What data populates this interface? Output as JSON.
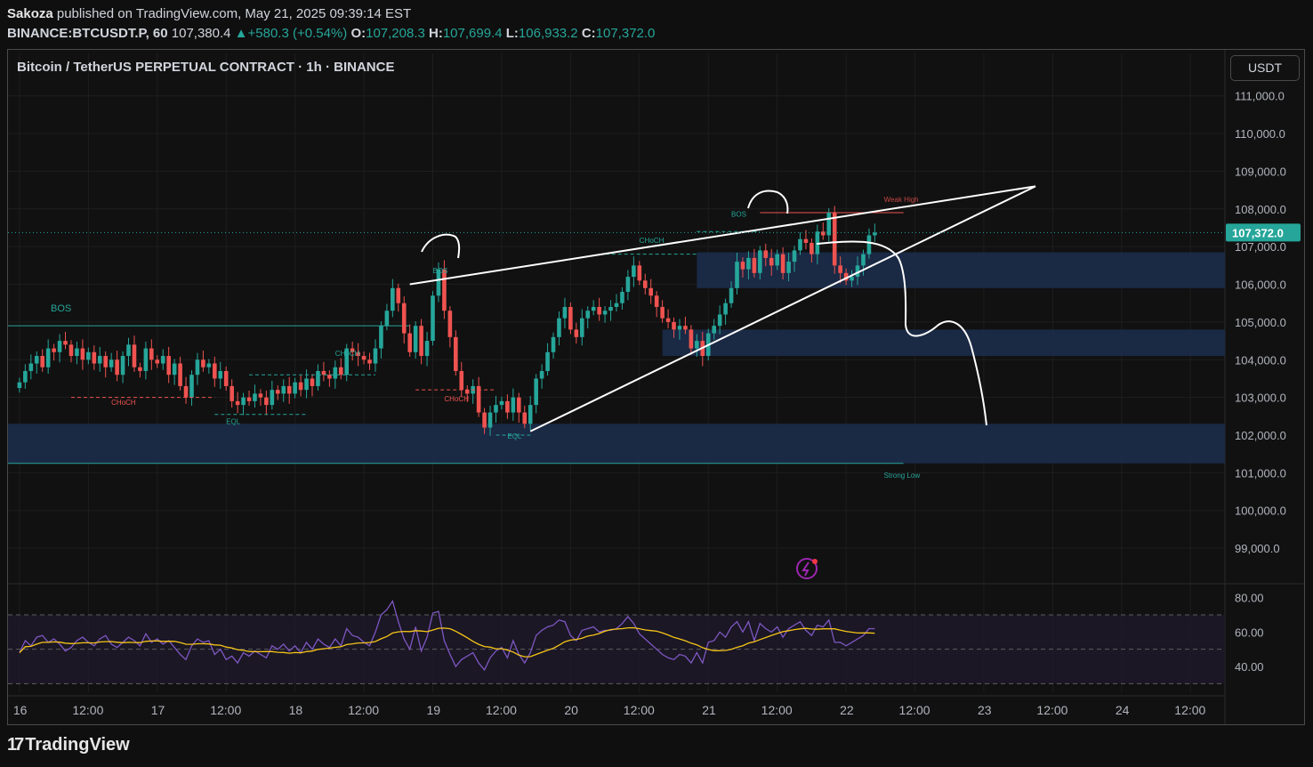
{
  "header": {
    "author": "Sakoza",
    "published_text": "published on TradingView.com, May 21, 2025 09:39:14 EST",
    "symbol": "BINANCE:BTCUSDT.P, 60",
    "last": "107,380.4",
    "change": "▲+580.3 (+0.54%)",
    "o_label": "O:",
    "o": "107,208.3",
    "h_label": "H:",
    "h": "107,699.4",
    "l_label": "L:",
    "l": "106,933.2",
    "c_label": "C:",
    "c": "107,372.0"
  },
  "chart_title": "Bitcoin / TetherUS PERPETUAL CONTRACT · 1h · BINANCE",
  "currency_button": "USDT",
  "footer": {
    "brand": "TradingView"
  },
  "colors": {
    "up": "#26a69a",
    "down": "#ef5350",
    "zone": "#1c2c4a",
    "bos": "#26a69a",
    "choch_red": "#ef5350",
    "rsi": "#7e57c2",
    "rsi_ma": "#f5c518",
    "price_tag": "#26a69a"
  },
  "chart_data": {
    "type": "candlestick",
    "title": "Bitcoin / TetherUS PERPETUAL CONTRACT · 1h · BINANCE",
    "y_ticks": [
      "111,000.0",
      "110,000.0",
      "109,000.0",
      "108,000.0",
      "107,000.0",
      "106,000.0",
      "105,000.0",
      "104,000.0",
      "103,000.0",
      "102,000.0",
      "101,000.0",
      "100,000.0",
      "99,000.0"
    ],
    "y_tick_values": [
      111000,
      110000,
      109000,
      108000,
      107000,
      106000,
      105000,
      104000,
      103000,
      102000,
      101000,
      100000,
      99000
    ],
    "ylim": [
      98200,
      111300
    ],
    "x_ticks": [
      "16",
      "12:00",
      "17",
      "12:00",
      "18",
      "12:00",
      "19",
      "12:00",
      "20",
      "12:00",
      "21",
      "12:00",
      "22",
      "12:00",
      "23",
      "12:00",
      "24",
      "12:00"
    ],
    "x_tick_hours": [
      0,
      12,
      24,
      36,
      48,
      60,
      72,
      84,
      96,
      108,
      120,
      132,
      144,
      156,
      168,
      180,
      192,
      204
    ],
    "x_axis_start": "May 16 00:00",
    "xlim_hours": [
      -2,
      210
    ],
    "last_price": "107,372.0",
    "last_price_value": 107372,
    "candles_hourly_close": [
      103400,
      103700,
      103900,
      104100,
      103800,
      104300,
      104200,
      104500,
      104400,
      104100,
      104300,
      104000,
      104200,
      103900,
      104100,
      103800,
      104000,
      103600,
      104100,
      104400,
      103800,
      103700,
      104300,
      104000,
      103900,
      104100,
      103600,
      103900,
      103300,
      103000,
      103600,
      104000,
      103800,
      103900,
      103500,
      103700,
      103300,
      102900,
      102800,
      103000,
      102900,
      103100,
      103000,
      102800,
      103200,
      103100,
      103300,
      103100,
      103400,
      103200,
      103500,
      103300,
      103700,
      103600,
      103500,
      103800,
      103600,
      104300,
      104200,
      104100,
      104000,
      103900,
      104300,
      104900,
      105300,
      105900,
      105500,
      104700,
      104200,
      104900,
      104100,
      104500,
      105700,
      106400,
      105300,
      104600,
      103700,
      103200,
      103100,
      103300,
      102600,
      102200,
      102600,
      102800,
      102900,
      102600,
      103000,
      102600,
      102300,
      102800,
      103500,
      103700,
      104200,
      104600,
      105100,
      105400,
      104800,
      104600,
      105100,
      105300,
      105400,
      105200,
      105300,
      105400,
      105500,
      105800,
      106200,
      106500,
      106100,
      105900,
      105700,
      105400,
      105100,
      105000,
      104800,
      104900,
      104800,
      104300,
      104500,
      104100,
      104700,
      104900,
      105200,
      105500,
      105900,
      106600,
      106400,
      106700,
      106300,
      106900,
      106700,
      106500,
      106800,
      106300,
      106600,
      106900,
      107200,
      107100,
      106800,
      107400,
      107300,
      107900,
      106500,
      106300,
      106100,
      106200,
      106500,
      106800,
      107300,
      107372
    ],
    "horizontal_levels": [
      {
        "label": "BOS",
        "value": 104900,
        "from_hour": -2,
        "to_hour": 68,
        "color": "bos"
      },
      {
        "label": "Strong Low",
        "value": 101250,
        "from_hour": -2,
        "to_hour": 154,
        "color": "bos"
      },
      {
        "label": "Weak High",
        "value": 107900,
        "from_hour": 129,
        "to_hour": 154,
        "color": "down"
      }
    ],
    "zones": [
      {
        "from_hour": 118,
        "to_hour": 210,
        "top": 106850,
        "bottom": 105900
      },
      {
        "from_hour": 112,
        "to_hour": 210,
        "top": 104800,
        "bottom": 104100
      },
      {
        "from_hour": -2,
        "to_hour": 210,
        "top": 102300,
        "bottom": 101250
      }
    ],
    "annotations": [
      {
        "text": "BOS",
        "hour": 72,
        "value": 106300,
        "color": "bos"
      },
      {
        "text": "CHoCH",
        "hour": 55,
        "value": 104100,
        "color": "bos"
      },
      {
        "text": "CHoCH",
        "hour": 16,
        "value": 102800,
        "color": "down"
      },
      {
        "text": "EQL",
        "hour": 36,
        "value": 102300,
        "color": "bos"
      },
      {
        "text": "CHoCH",
        "hour": 74,
        "value": 102900,
        "color": "down"
      },
      {
        "text": "EQL",
        "hour": 85,
        "value": 101900,
        "color": "bos"
      },
      {
        "text": "CHoCH",
        "hour": 108,
        "value": 107100,
        "color": "bos"
      },
      {
        "text": "BOS",
        "hour": 124,
        "value": 107800,
        "color": "bos"
      }
    ],
    "rsi": {
      "y_ticks": [
        "80.00",
        "60.00",
        "40.00"
      ],
      "y_tick_values": [
        80,
        60,
        40
      ],
      "ylim": [
        25,
        85
      ],
      "upper": 70,
      "lower": 30,
      "mid": 50,
      "values": [
        48,
        55,
        52,
        57,
        58,
        54,
        56,
        53,
        49,
        51,
        55,
        57,
        54,
        52,
        56,
        58,
        53,
        51,
        54,
        57,
        55,
        52,
        59,
        54,
        56,
        53,
        55,
        51,
        47,
        44,
        52,
        56,
        54,
        55,
        47,
        50,
        44,
        46,
        42,
        48,
        46,
        49,
        47,
        45,
        52,
        50,
        53,
        49,
        52,
        48,
        54,
        50,
        56,
        53,
        51,
        56,
        52,
        62,
        58,
        57,
        54,
        52,
        60,
        70,
        73,
        78,
        66,
        56,
        50,
        63,
        49,
        57,
        71,
        72,
        55,
        47,
        40,
        44,
        46,
        48,
        42,
        38,
        45,
        49,
        51,
        45,
        55,
        47,
        42,
        48,
        58,
        61,
        63,
        64,
        67,
        66,
        58,
        55,
        61,
        62,
        63,
        60,
        61,
        61,
        62,
        65,
        69,
        65,
        59,
        56,
        53,
        50,
        47,
        45,
        44,
        47,
        46,
        42,
        48,
        42,
        54,
        55,
        60,
        57,
        63,
        66,
        60,
        66,
        55,
        65,
        62,
        60,
        63,
        57,
        62,
        64,
        66,
        61,
        58,
        64,
        63,
        67,
        54,
        54,
        52,
        54,
        56,
        58,
        62,
        62
      ]
    }
  }
}
